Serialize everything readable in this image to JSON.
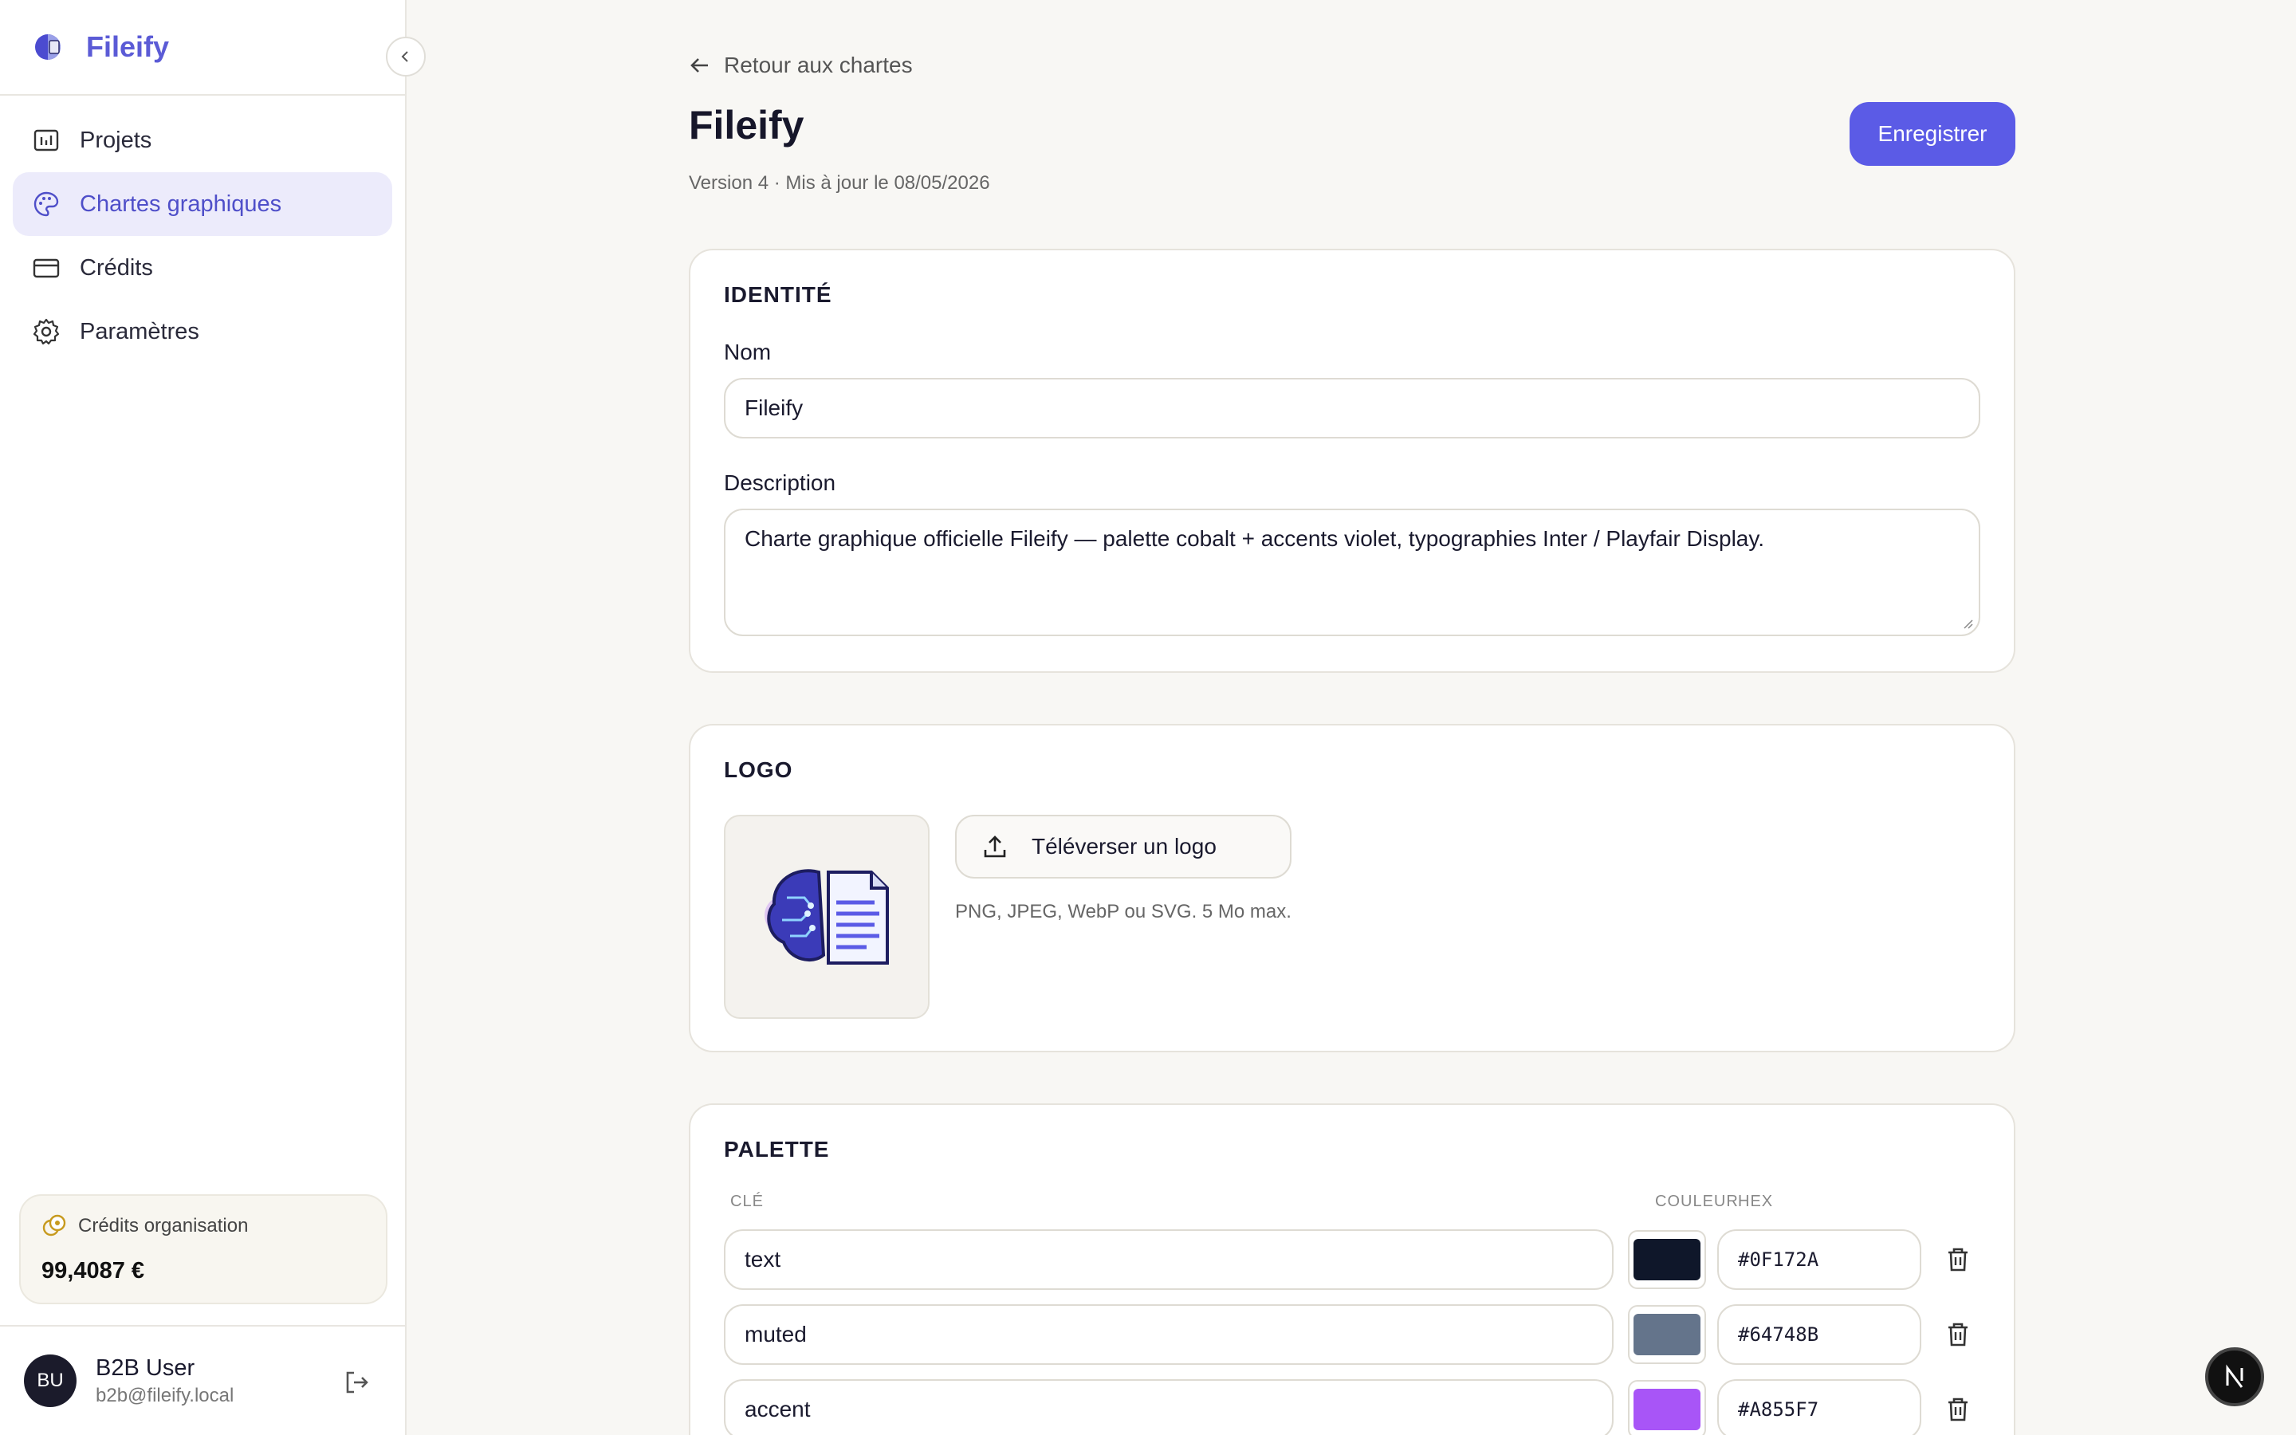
{
  "app": {
    "name": "Fileify"
  },
  "sidebar": {
    "items": [
      {
        "label": "Projets",
        "icon": "chart-icon"
      },
      {
        "label": "Chartes graphiques",
        "icon": "palette-icon",
        "active": true
      },
      {
        "label": "Crédits",
        "icon": "credit-card-icon"
      },
      {
        "label": "Paramètres",
        "icon": "gear-icon"
      }
    ],
    "credits": {
      "label": "Crédits organisation",
      "value": "99,4087 €"
    },
    "user": {
      "initials": "BU",
      "name": "B2B User",
      "email": "b2b@fileify.local"
    }
  },
  "header": {
    "back_label": "Retour aux chartes",
    "title": "Fileify",
    "meta": "Version 4 · Mis à jour le 08/05/2026",
    "save_label": "Enregistrer"
  },
  "identity": {
    "title": "IDENTITÉ",
    "name_label": "Nom",
    "name_value": "Fileify",
    "description_label": "Description",
    "description_value": "Charte graphique officielle Fileify — palette cobalt + accents violet, typographies Inter / Playfair Display."
  },
  "logo": {
    "title": "LOGO",
    "upload_label": "Téléverser un logo",
    "hint": "PNG, JPEG, WebP ou SVG. 5 Mo max."
  },
  "palette": {
    "title": "PALETTE",
    "col_key": "CLÉ",
    "col_color": "COULEUR",
    "col_hex": "HEX",
    "rows": [
      {
        "key": "text",
        "hex": "#0F172A"
      },
      {
        "key": "muted",
        "hex": "#64748B"
      },
      {
        "key": "accent",
        "hex": "#A855F7"
      }
    ]
  },
  "colors": {
    "accent": "#5b5be6",
    "brand": "#5b5bd6"
  }
}
